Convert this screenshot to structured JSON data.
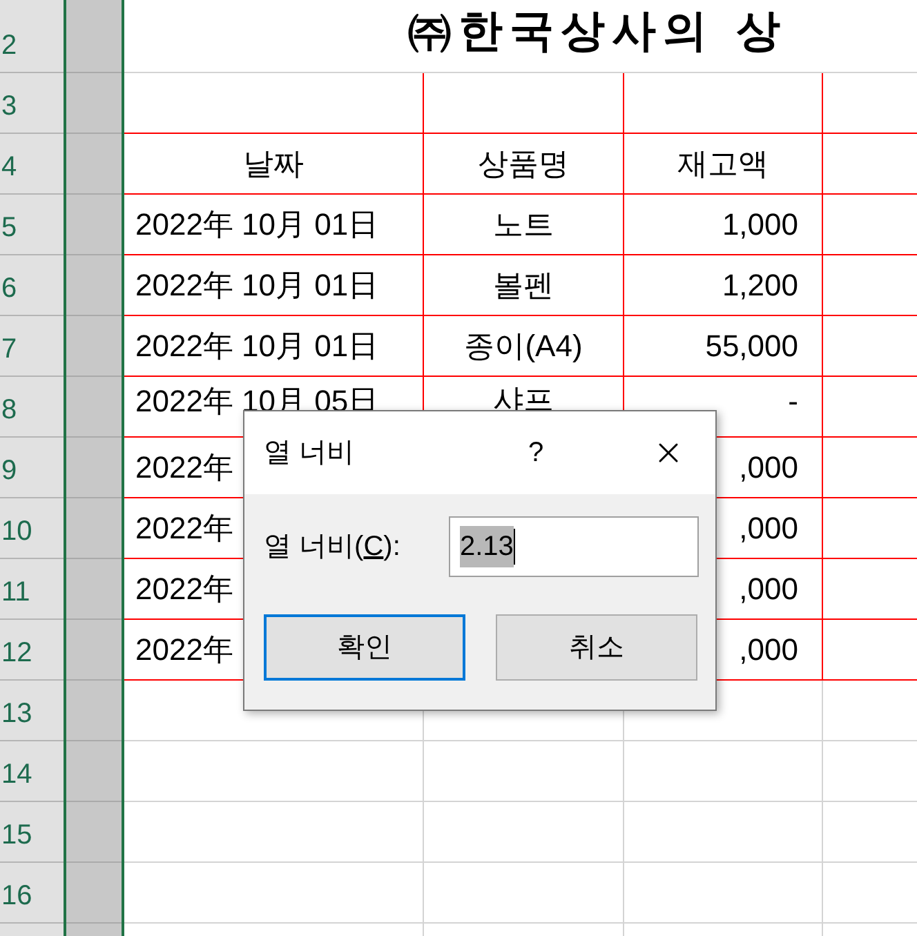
{
  "title": "㈜한국상사의 상",
  "row_headers": [
    "2",
    "3",
    "4",
    "5",
    "6",
    "7",
    "8",
    "9",
    "10",
    "11",
    "12",
    "13",
    "14",
    "15",
    "16"
  ],
  "header": [
    "날짜",
    "상품명",
    "재고액"
  ],
  "rows": [
    {
      "date": "2022年 10月 01日",
      "product": "노트",
      "amount": "1,000"
    },
    {
      "date": "2022年 10月 01日",
      "product": "볼펜",
      "amount": "1,200"
    },
    {
      "date": "2022年 10月 01日",
      "product": "종이(A4)",
      "amount": "55,000"
    },
    {
      "date": "2022年 10月 05日",
      "product": "샤프",
      "amount": "-"
    },
    {
      "date": "2022年",
      "amount": ",000"
    },
    {
      "date": "2022年",
      "amount": ",000"
    },
    {
      "date": "2022年",
      "amount": ",000"
    },
    {
      "date": "2022年",
      "amount": ",000"
    }
  ],
  "dialog": {
    "title": "열 너비",
    "help": "?",
    "label": {
      "before": "열 너비(",
      "key": "C",
      "after": "):"
    },
    "value": "2.13",
    "text_selected": true,
    "buttons": [
      {
        "label": "확인",
        "focused": true
      },
      {
        "label": "취소",
        "focused": false
      }
    ]
  }
}
